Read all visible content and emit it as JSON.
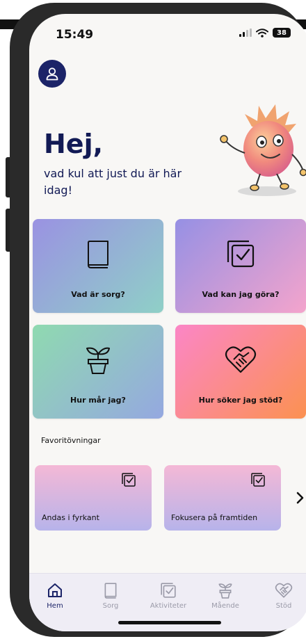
{
  "status_bar": {
    "time": "15:49",
    "battery": "38"
  },
  "header": {
    "greeting": "Hej,",
    "subgreeting": "vad kul att just du är här idag!"
  },
  "cards": [
    {
      "label": "Vad är sorg?",
      "icon": "book-icon"
    },
    {
      "label": "Vad kan jag göra?",
      "icon": "checklist-icon"
    },
    {
      "label": "Hur mår jag?",
      "icon": "plant-icon"
    },
    {
      "label": "Hur söker jag stöd?",
      "icon": "heart-handshake-icon"
    }
  ],
  "favorites": {
    "title": "Favoritövningar",
    "items": [
      {
        "label": "Andas i fyrkant",
        "icon": "checklist-icon"
      },
      {
        "label": "Fokusera på framtiden",
        "icon": "checklist-icon"
      }
    ]
  },
  "tabbar": {
    "items": [
      {
        "label": "Hem",
        "icon": "home-icon",
        "active": true
      },
      {
        "label": "Sorg",
        "icon": "book-icon"
      },
      {
        "label": "Aktiviteter",
        "icon": "checklist-icon"
      },
      {
        "label": "Mående",
        "icon": "plant-icon"
      },
      {
        "label": "Stöd",
        "icon": "heart-handshake-icon"
      }
    ]
  },
  "colors": {
    "primary": "#1c2468",
    "background": "#f8f7f5",
    "tab_inactive": "#9a9aa8"
  }
}
